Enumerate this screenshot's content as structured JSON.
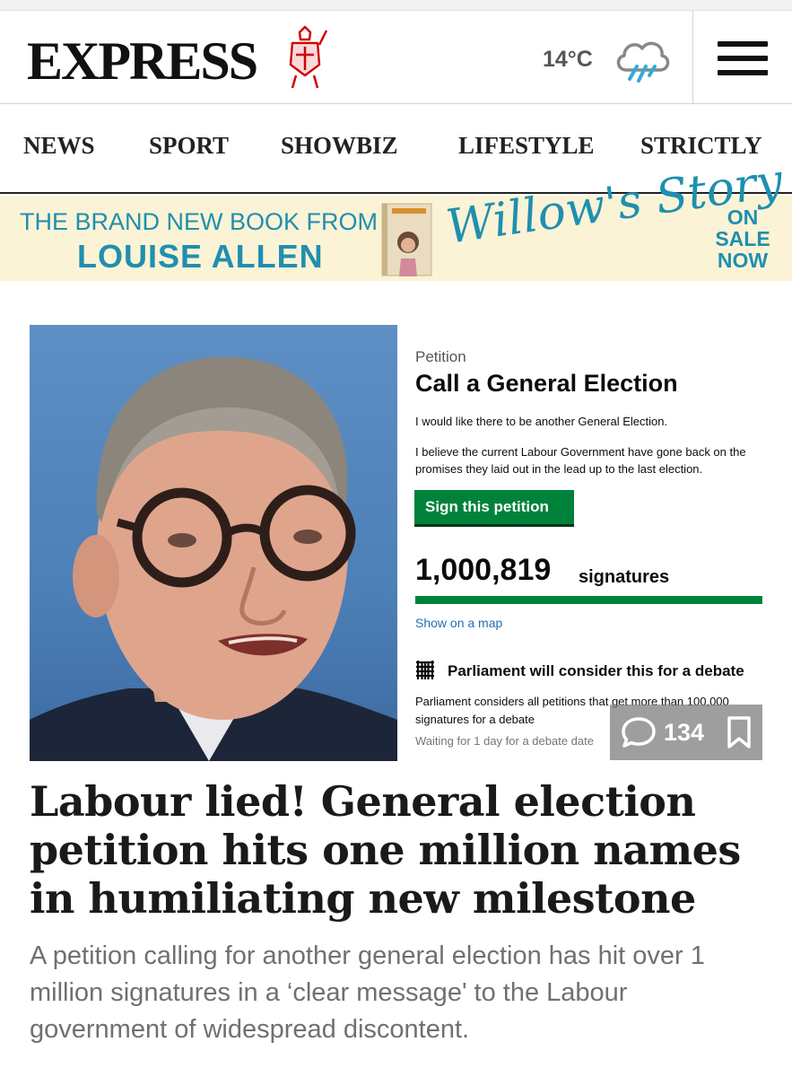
{
  "header": {
    "logo_text": "EXPRESS",
    "temperature": "14°C",
    "weather_icon": "rain-cloud-icon",
    "menu_icon": "hamburger-menu-icon",
    "brand_red": "#d40000"
  },
  "nav": {
    "items": [
      "NEWS",
      "SPORT",
      "SHOWBIZ",
      "LIFESTYLE",
      "STRICTLY"
    ]
  },
  "banner": {
    "line1": "THE BRAND NEW BOOK FROM",
    "line2": "LOUISE ALLEN",
    "book_title": "Willow's Story",
    "on_sale": [
      "ON",
      "SALE",
      "NOW"
    ],
    "accent": "#1f8fb0",
    "background": "#fbf3d5"
  },
  "petition": {
    "label": "Petition",
    "title": "Call a General Election",
    "text1": "I would like there to be another General Election.",
    "text2": "I believe the current Labour Government have gone back on the promises they laid out in the lead up to the last election.",
    "sign_button": "Sign this petition",
    "signature_count": "1,000,819",
    "signatures_word": "signatures",
    "map_link": "Show on a map",
    "parliament_heading": "Parliament will consider this for a debate",
    "parliament_text": "Parliament considers all petitions that get more than 100,000 signatures for a debate",
    "waiting_text": "Waiting for 1 day for a debate date",
    "button_green": "#00823b"
  },
  "article": {
    "comment_count": "134",
    "comment_icon": "speech-bubble-icon",
    "bookmark_icon": "bookmark-icon",
    "headline": "Labour lied! General election petition hits one million names in humiliating new milestone",
    "standfirst": "A petition calling for another general election has hit over 1 million signatures in a ‘clear message' to the Labour government of widespread discontent."
  }
}
